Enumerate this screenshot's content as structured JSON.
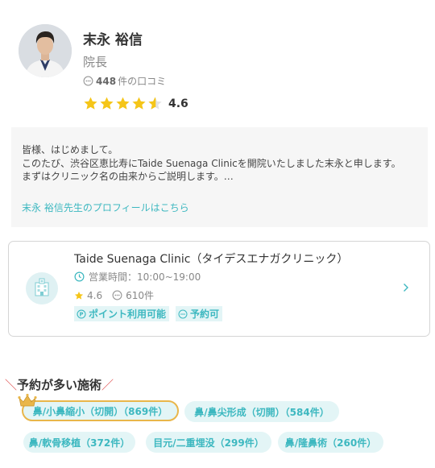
{
  "doctor": {
    "name": "末永 裕信",
    "title": "院長",
    "review_count": "448",
    "review_suffix": "件の口コミ",
    "rating": "4.6"
  },
  "greeting": {
    "lines": [
      "皆様、はじめまして。",
      "このたび、渋谷区恵比寿にTaide Suenaga Clinicを開院いたしました末永と申します。",
      "まずはクリニック名の由来からご説明します。…"
    ],
    "profile_link": "末永 裕信先生のプロフィールはこちら"
  },
  "clinic": {
    "name": "Taide Suenaga Clinic（タイデスエナガクリニック）",
    "hours": "営業時間：10:00~19:00",
    "rating": "4.6",
    "reviews": "610件",
    "tag_points": "ポイント利用可能",
    "tag_booking": "予約可"
  },
  "popular": {
    "title": "予約が多い施術",
    "items": [
      "鼻/小鼻縮小（切開）（869件）",
      "鼻/鼻尖形成（切開）（584件）",
      "鼻/軟骨移植（372件）",
      "目元/二重埋没（299件）",
      "鼻/隆鼻術（260件）"
    ]
  },
  "colors": {
    "accent": "#3db8c0",
    "star": "#f5c518",
    "crown": "#e9b64a",
    "chip_bg": "#e3f5f6"
  }
}
